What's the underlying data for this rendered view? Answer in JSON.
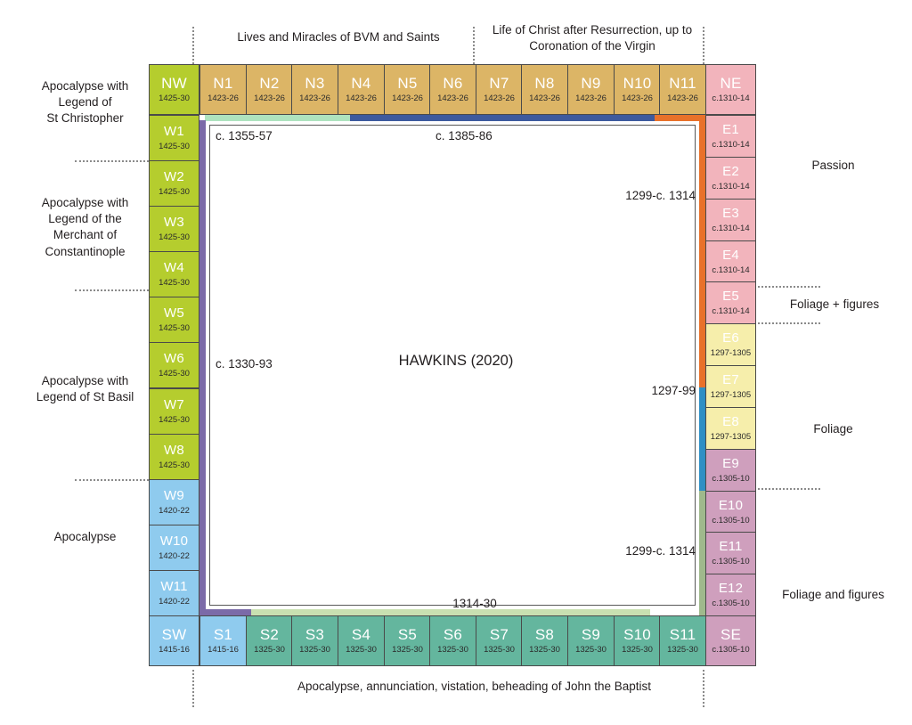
{
  "diagram": {
    "center_label": "HAWKINS (2020)",
    "top_captions": [
      "Lives and Miracles of BVM and Saints",
      "Life of Christ after Resurrection, up to\nCoronation of the Virgin"
    ],
    "bottom_caption": "Apocalypse, annunciation, vistation, beheading of John the Baptist",
    "left_captions": [
      "Apocalypse with\nLegend of\nSt Christopher",
      "Apocalypse with\nLegend of the\nMerchant of\nConstantinople",
      "Apocalypse with\nLegend of St Basil",
      "Apocalypse"
    ],
    "right_captions": [
      "Passion",
      "Foliage + figures",
      "Foliage",
      "Foliage and figures"
    ],
    "inner_labels": [
      "c. 1355-57",
      "c. 1385-86",
      "1299-c. 1314",
      "c. 1330-93",
      "1297-99",
      "1299-c. 1314",
      "1314-30"
    ]
  },
  "colors": {
    "green": "#b5cd2e",
    "tan": "#dcb566",
    "pink": "#f2b4bc",
    "blue": "#8fcbee",
    "teal": "#64b69e",
    "yellow": "#f6eeab",
    "mauve": "#cf9fbd",
    "strip_purple": "#7b6aa8",
    "strip_lightgreen": "#aee3bf",
    "strip_darkblue": "#3d5a9e",
    "strip_orange": "#e8712a",
    "strip_cyan": "#2f8fc4",
    "strip_sage": "#9fb98c",
    "strip_palegreen": "#c9e0b1"
  },
  "north": {
    "corner_west": {
      "label": "NW",
      "date": "1425-30",
      "color": "#b5cd2e"
    },
    "cells": [
      {
        "label": "N1",
        "date": "1423-26",
        "color": "#dcb566"
      },
      {
        "label": "N2",
        "date": "1423-26",
        "color": "#dcb566"
      },
      {
        "label": "N3",
        "date": "1423-26",
        "color": "#dcb566"
      },
      {
        "label": "N4",
        "date": "1423-26",
        "color": "#dcb566"
      },
      {
        "label": "N5",
        "date": "1423-26",
        "color": "#dcb566"
      },
      {
        "label": "N6",
        "date": "1423-26",
        "color": "#dcb566"
      },
      {
        "label": "N7",
        "date": "1423-26",
        "color": "#dcb566"
      },
      {
        "label": "N8",
        "date": "1423-26",
        "color": "#dcb566"
      },
      {
        "label": "N9",
        "date": "1423-26",
        "color": "#dcb566"
      },
      {
        "label": "N10",
        "date": "1423-26",
        "color": "#dcb566"
      },
      {
        "label": "N11",
        "date": "1423-26",
        "color": "#dcb566"
      }
    ],
    "corner_east": {
      "label": "NE",
      "date": "c.1310-14",
      "color": "#f2b4bc"
    }
  },
  "west": {
    "cells": [
      {
        "label": "W1",
        "date": "1425-30",
        "color": "#b5cd2e"
      },
      {
        "label": "W2",
        "date": "1425-30",
        "color": "#b5cd2e"
      },
      {
        "label": "W3",
        "date": "1425-30",
        "color": "#b5cd2e"
      },
      {
        "label": "W4",
        "date": "1425-30",
        "color": "#b5cd2e"
      },
      {
        "label": "W5",
        "date": "1425-30",
        "color": "#b5cd2e"
      },
      {
        "label": "W6",
        "date": "1425-30",
        "color": "#b5cd2e"
      },
      {
        "label": "W7",
        "date": "1425-30",
        "color": "#b5cd2e"
      },
      {
        "label": "W8",
        "date": "1425-30",
        "color": "#b5cd2e"
      },
      {
        "label": "W9",
        "date": "1420-22",
        "color": "#8fcbee"
      },
      {
        "label": "W10",
        "date": "1420-22",
        "color": "#8fcbee"
      },
      {
        "label": "W11",
        "date": "1420-22",
        "color": "#8fcbee"
      }
    ]
  },
  "east": {
    "cells": [
      {
        "label": "E1",
        "date": "c.1310-14",
        "color": "#f2b4bc"
      },
      {
        "label": "E2",
        "date": "c.1310-14",
        "color": "#f2b4bc"
      },
      {
        "label": "E3",
        "date": "c.1310-14",
        "color": "#f2b4bc"
      },
      {
        "label": "E4",
        "date": "c.1310-14",
        "color": "#f2b4bc"
      },
      {
        "label": "E5",
        "date": "c.1310-14",
        "color": "#f2b4bc"
      },
      {
        "label": "E6",
        "date": "1297-1305",
        "color": "#f6eeab"
      },
      {
        "label": "E7",
        "date": "1297-1305",
        "color": "#f6eeab"
      },
      {
        "label": "E8",
        "date": "1297-1305",
        "color": "#f6eeab"
      },
      {
        "label": "E9",
        "date": "c.1305-10",
        "color": "#cf9fbd"
      },
      {
        "label": "E10",
        "date": "c.1305-10",
        "color": "#cf9fbd"
      },
      {
        "label": "E11",
        "date": "c.1305-10",
        "color": "#cf9fbd"
      },
      {
        "label": "E12",
        "date": "c.1305-10",
        "color": "#cf9fbd"
      }
    ]
  },
  "south": {
    "corner_west": {
      "label": "SW",
      "date": "1415-16",
      "color": "#8fcbee"
    },
    "cells": [
      {
        "label": "S1",
        "date": "1415-16",
        "color": "#8fcbee"
      },
      {
        "label": "S2",
        "date": "1325-30",
        "color": "#64b69e"
      },
      {
        "label": "S3",
        "date": "1325-30",
        "color": "#64b69e"
      },
      {
        "label": "S4",
        "date": "1325-30",
        "color": "#64b69e"
      },
      {
        "label": "S5",
        "date": "1325-30",
        "color": "#64b69e"
      },
      {
        "label": "S6",
        "date": "1325-30",
        "color": "#64b69e"
      },
      {
        "label": "S7",
        "date": "1325-30",
        "color": "#64b69e"
      },
      {
        "label": "S8",
        "date": "1325-30",
        "color": "#64b69e"
      },
      {
        "label": "S9",
        "date": "1325-30",
        "color": "#64b69e"
      },
      {
        "label": "S10",
        "date": "1325-30",
        "color": "#64b69e"
      },
      {
        "label": "S11",
        "date": "1325-30",
        "color": "#64b69e"
      }
    ],
    "corner_east": {
      "label": "SE",
      "date": "c.1305-10",
      "color": "#cf9fbd"
    }
  }
}
